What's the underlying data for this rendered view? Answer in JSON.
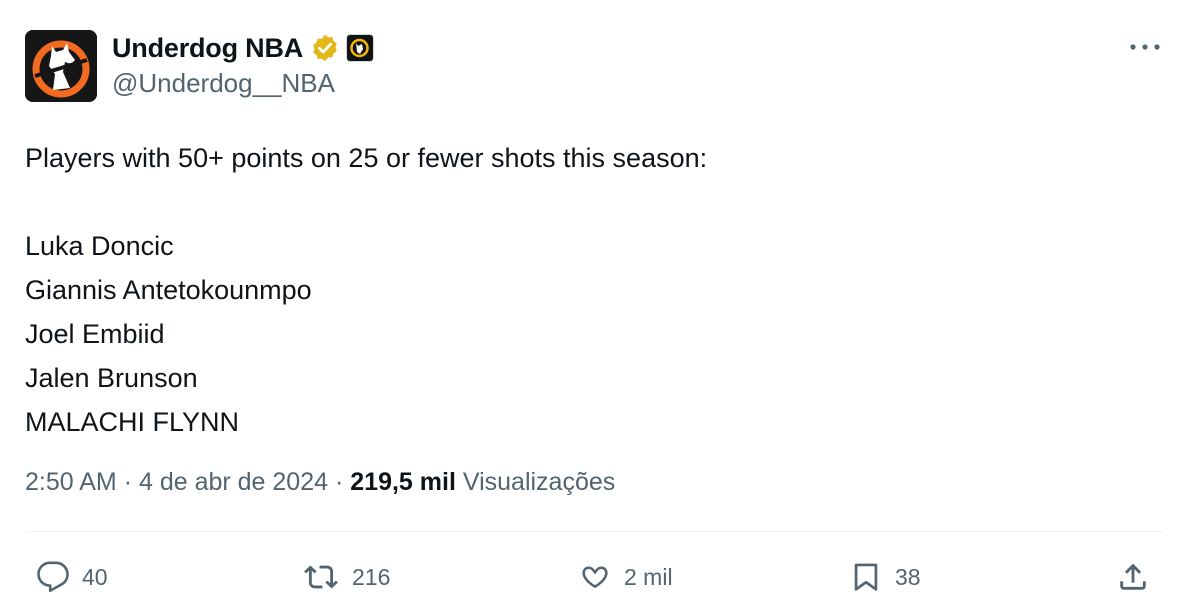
{
  "author": {
    "display_name": "Underdog NBA",
    "handle": "@Underdog__NBA",
    "verified_icon": "gold-verified-badge-icon",
    "affiliate_icon": "underdog-affiliate-badge-icon",
    "avatar_icon": "underdog-dog-logo-icon",
    "more_icon": "more-dots-icon"
  },
  "tweet": {
    "headline": "Players with 50+ points on 25 or fewer shots this season:",
    "players": [
      "Luka Doncic",
      "Giannis Antetokounmpo",
      "Joel Embiid",
      "Jalen Brunson",
      "MALACHI FLYNN"
    ]
  },
  "meta": {
    "time": "2:50 AM",
    "separator": "·",
    "date": "4 de abr de 2024",
    "views_count": "219,5 mil",
    "views_label": "Visualizações"
  },
  "actions": {
    "reply_count": "40",
    "retweet_count": "216",
    "like_count": "2 mil",
    "bookmark_count": "38"
  },
  "colors": {
    "text": "#0f1419",
    "secondary": "#536471",
    "verified_gold": "#e2b719",
    "avatar_orange": "#f26b21",
    "divider": "#eff3f4"
  }
}
